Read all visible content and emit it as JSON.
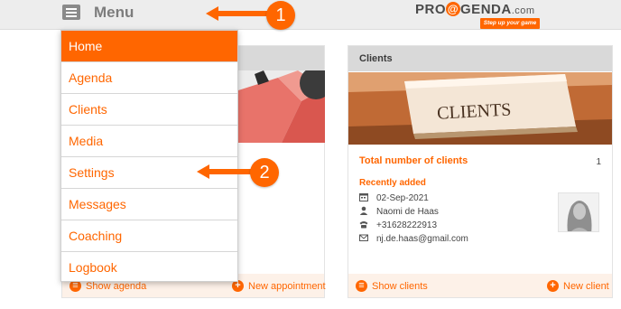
{
  "header": {
    "menu_label": "Menu",
    "logo_text_before": "PRO",
    "logo_at": "@",
    "logo_text_after": "GENDA",
    "logo_domain": ".com",
    "logo_tagline": "Step up your game"
  },
  "menu": {
    "items": [
      {
        "label": "Home",
        "active": true
      },
      {
        "label": "Agenda"
      },
      {
        "label": "Clients"
      },
      {
        "label": "Media"
      },
      {
        "label": "Settings"
      },
      {
        "label": "Messages"
      },
      {
        "label": "Coaching"
      },
      {
        "label": "Logbook"
      }
    ]
  },
  "annotations": {
    "callout_1": "1",
    "callout_2": "2"
  },
  "agenda_card": {
    "footer_left": "Show agenda",
    "footer_right": "New appointment"
  },
  "clients_card": {
    "title": "Clients",
    "image_caption": "CLIENTS",
    "total_label": "Total number of clients",
    "total_value": "1",
    "recent_title": "Recently added",
    "recent": {
      "date": "02-Sep-2021",
      "name": "Naomi de Haas",
      "phone": "+31628222913",
      "email": "nj.de.haas@gmail.com"
    },
    "footer_left": "Show clients",
    "footer_right": "New client"
  },
  "colors": {
    "accent": "#ff6600",
    "header_bg": "#ededed",
    "card_header_bg": "#d9d9d9",
    "footer_bg": "#fdf1e8"
  },
  "icons": [
    "menu-icon",
    "calendar-icon",
    "person-icon",
    "phone-icon",
    "envelope-icon",
    "list-icon",
    "plus-icon"
  ]
}
